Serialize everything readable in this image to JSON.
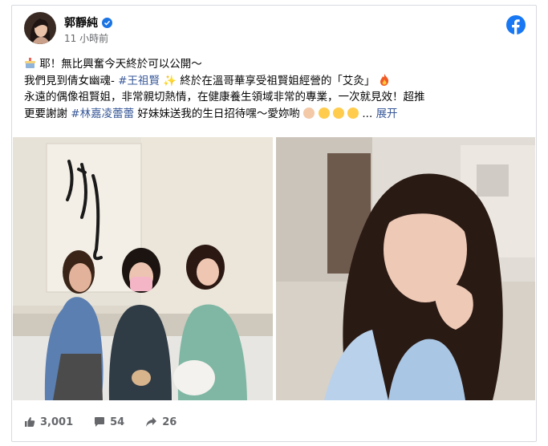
{
  "post": {
    "author": "郭靜純",
    "timestamp": "11 小時前",
    "text": {
      "line1": "耶！無比興奮今天終於可以公開～",
      "line2_prefix": "我們見到倩女幽魂-",
      "line2_hashtag": "#王祖賢",
      "line2_suffix": "終於在溫哥華享受祖賢姐經營的「艾灸」",
      "line3": "永遠的偶像祖賢姐，非常親切熱情，在健康養生領域非常的專業，一次就見效！超推",
      "line4_prefix": "更要謝謝",
      "line4_hashtag": "#林嘉凌蕾蕾",
      "line4_suffix": " 好妹妹送我的生日招待嘿～愛妳喲",
      "line4_ellipsis": "...",
      "see_more": "展开"
    }
  },
  "stats": {
    "likes": "3,001",
    "comments": "54",
    "shares": "26"
  },
  "icons": {
    "verified": "verified-badge-icon",
    "globe": "globe-icon",
    "facebook": "facebook-logo-icon",
    "like": "thumbs-up-icon",
    "comment": "comment-icon",
    "share": "share-arrow-icon"
  },
  "colors": {
    "brand_blue": "#1877f2",
    "hashtag": "#385898",
    "meta_gray": "#65676b"
  }
}
